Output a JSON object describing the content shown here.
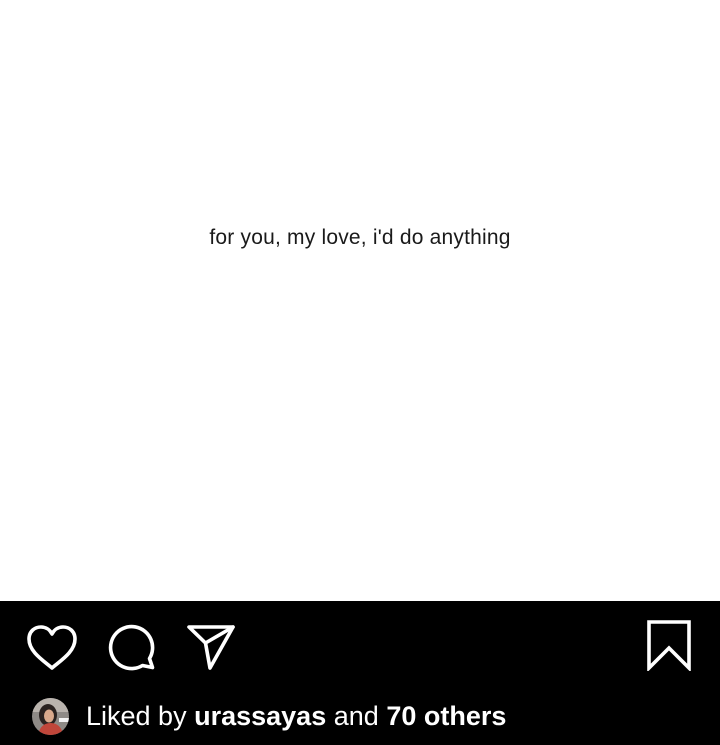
{
  "post": {
    "caption_image_text": "for you, my love, i'd do anything"
  },
  "actions": {
    "like_icon": "heart-outline-icon",
    "comment_icon": "comment-bubble-icon",
    "share_icon": "paper-plane-icon",
    "save_icon": "bookmark-outline-icon"
  },
  "likes": {
    "prefix": "Liked by",
    "user": "urassayas",
    "conjunction": "and",
    "others": "70 others"
  },
  "colors": {
    "background": "#000000",
    "post_background": "#ffffff",
    "icon": "#ffffff",
    "text": "#ffffff"
  }
}
